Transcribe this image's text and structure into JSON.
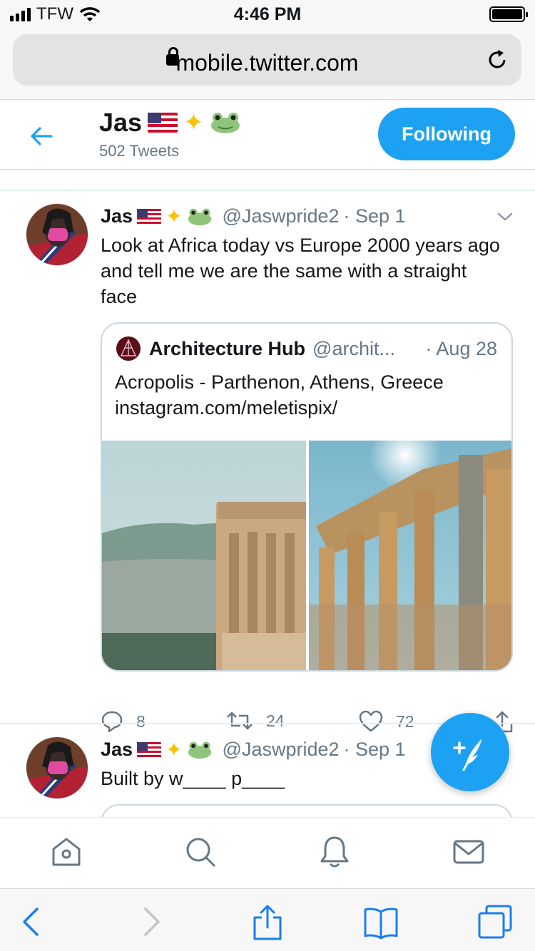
{
  "status_bar": {
    "carrier": "TFW",
    "time": "4:46 PM"
  },
  "browser": {
    "url": "mobile.twitter.com"
  },
  "profile_header": {
    "name": "Jas",
    "tweet_count": "502 Tweets",
    "follow_label": "Following"
  },
  "tweets": [
    {
      "name": "Jas",
      "handle": "@Jaswpride2",
      "date": "· Sep 1",
      "text": "Look at Africa today vs Europe 2000 years ago and tell me we are the same with a straight face",
      "quote": {
        "name": "Architecture Hub",
        "handle": "@archit...",
        "date": "· Aug 28",
        "text": "Acropolis - Parthenon, Athens, Greece instagram.com/meletispix/"
      },
      "replies": "8",
      "retweets": "24",
      "likes": "72"
    },
    {
      "name": "Jas",
      "handle": "@Jaswpride2",
      "date": "· Sep 1",
      "text": "Built by w____ p____"
    }
  ],
  "colors": {
    "accent": "#1da1f2",
    "muted": "#657786",
    "text": "#14171a"
  },
  "icons": [
    "back-arrow-icon",
    "lock-icon",
    "reload-icon",
    "chevron-down-icon",
    "reply-icon",
    "retweet-icon",
    "like-icon",
    "share-icon",
    "compose-icon",
    "home-icon",
    "search-icon",
    "notifications-icon",
    "messages-icon"
  ]
}
